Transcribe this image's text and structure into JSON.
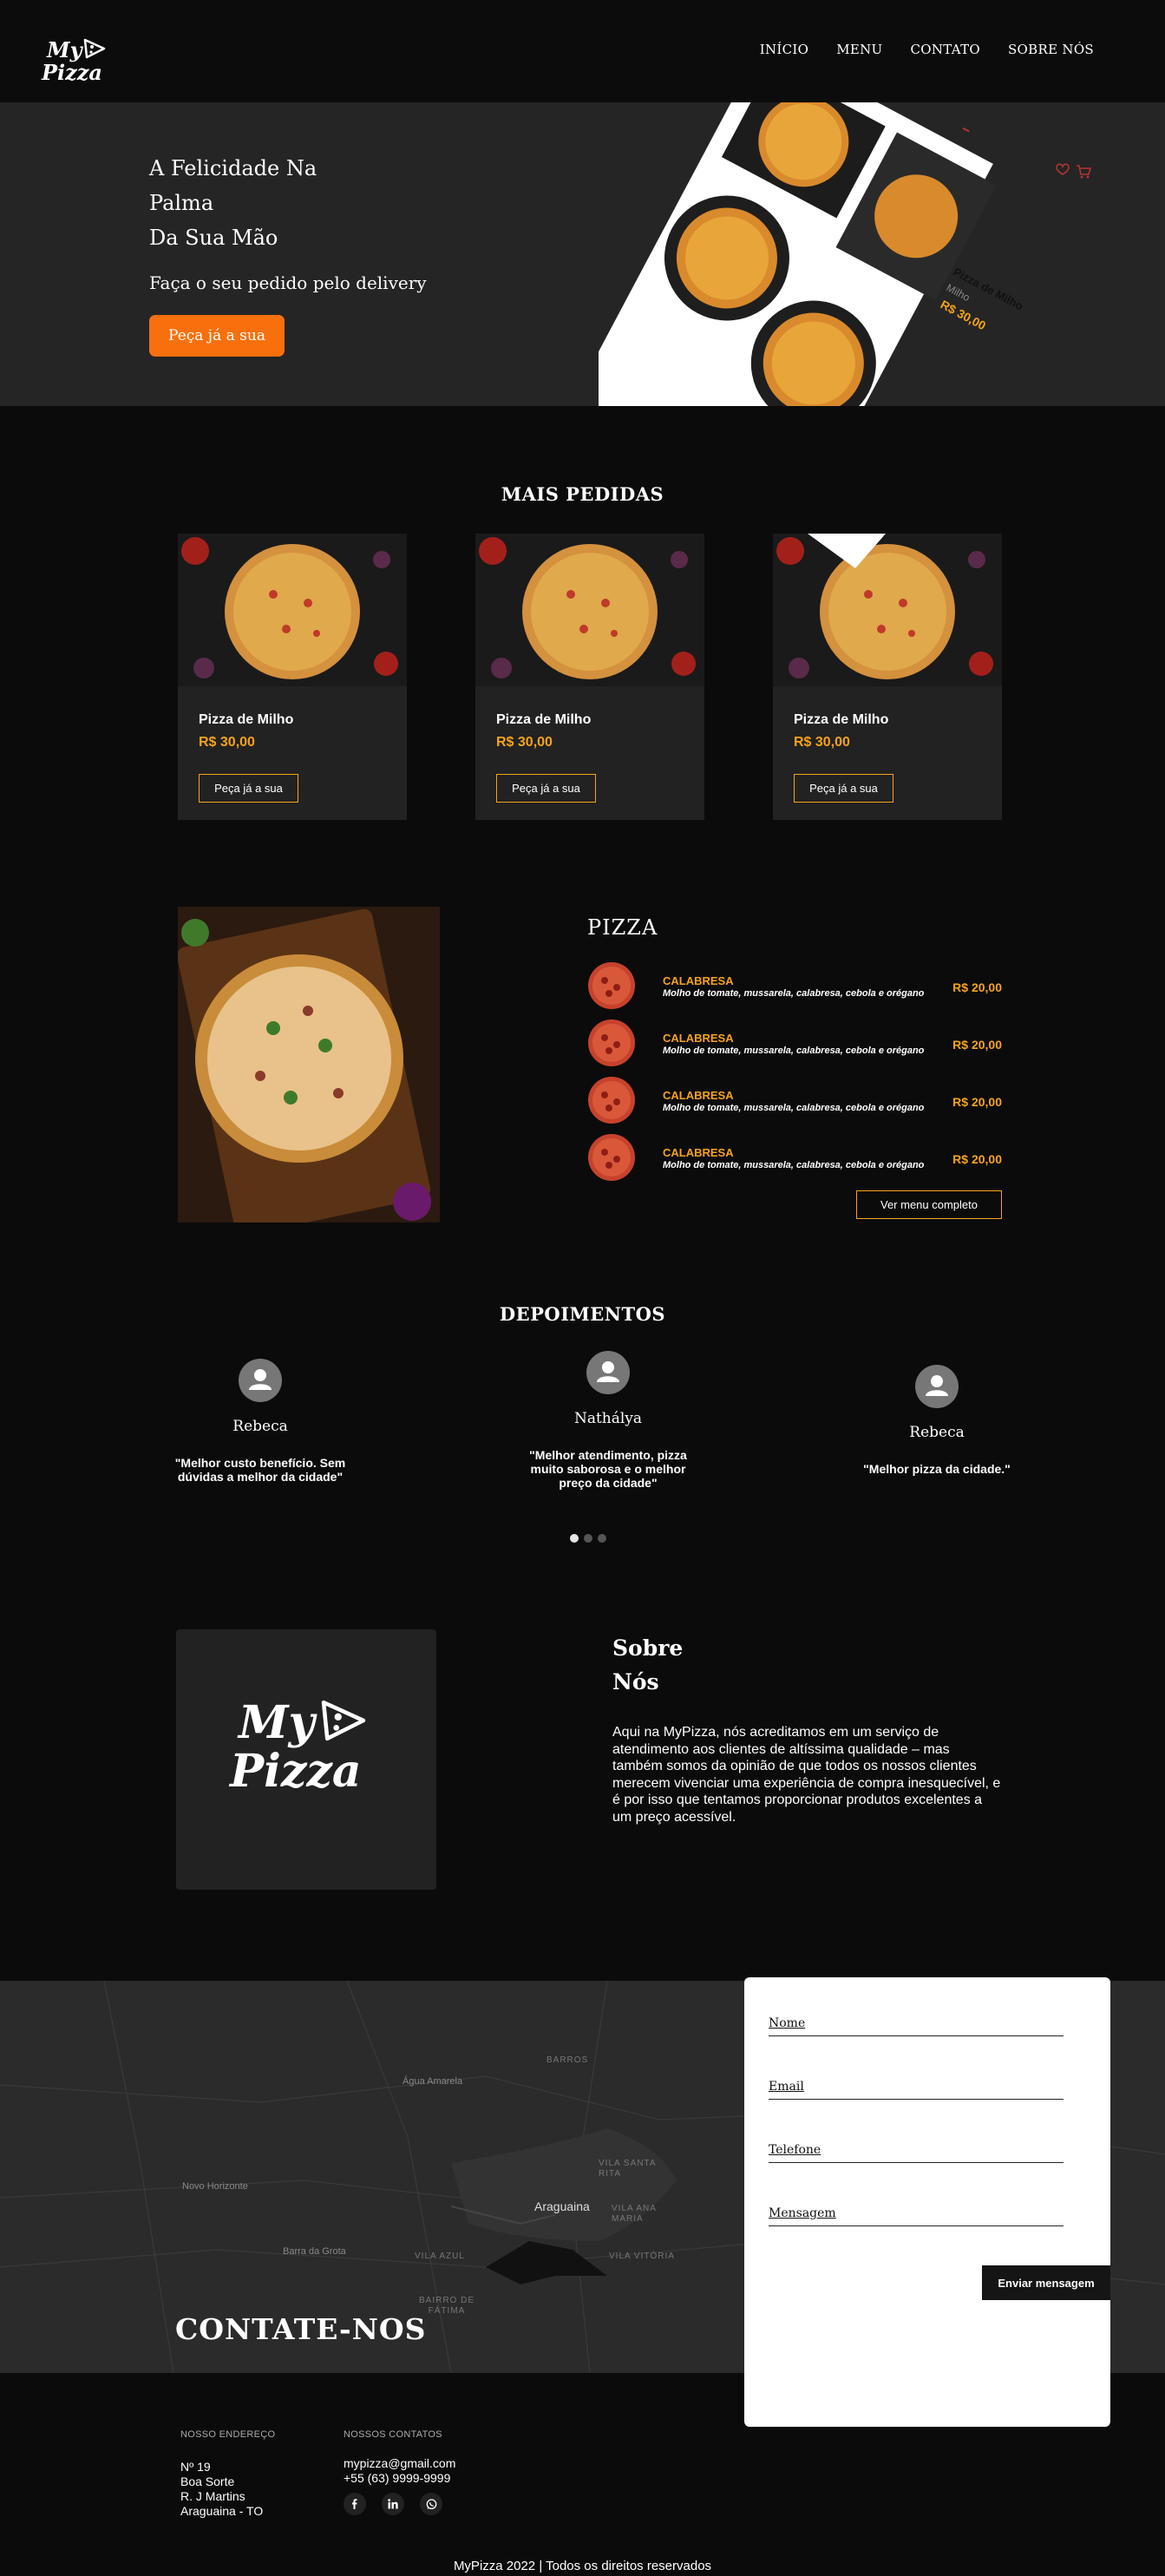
{
  "brand": {
    "logo_line1": "My",
    "logo_line2": "Pizza"
  },
  "nav": {
    "items": [
      "INÍCIO",
      "MENU",
      "CONTATO",
      "SOBRE NÓS"
    ]
  },
  "hero": {
    "lines": [
      "A Felicidade Na",
      "Palma",
      "Da Sua Mão"
    ],
    "subtitle": "Faça o seu pedido pelo delivery",
    "cta": "Peça já a sua",
    "mockup": {
      "product": "Pizza de Milho",
      "ingredient": "Milho",
      "price": "R$ 30,00"
    }
  },
  "featured": {
    "title": "MAIS PEDIDAS",
    "cards": [
      {
        "name": "Pizza de Milho",
        "price": "R$ 30,00",
        "cta": "Peça já a sua"
      },
      {
        "name": "Pizza de Milho",
        "price": "R$ 30,00",
        "cta": "Peça já a sua"
      },
      {
        "name": "Pizza de Milho",
        "price": "R$ 30,00",
        "cta": "Peça já a sua"
      }
    ]
  },
  "menu": {
    "title": "PIZZA",
    "items": [
      {
        "name": "CALABRESA",
        "desc": "Molho de tomate, mussarela, calabresa, cebola e orégano",
        "price": "R$ 20,00"
      },
      {
        "name": "CALABRESA",
        "desc": "Molho de tomate, mussarela, calabresa, cebola e orégano",
        "price": "R$ 20,00"
      },
      {
        "name": "CALABRESA",
        "desc": "Molho de tomate, mussarela, calabresa, cebola e orégano",
        "price": "R$ 20,00"
      },
      {
        "name": "CALABRESA",
        "desc": "Molho de tomate, mussarela, calabresa, cebola e orégano",
        "price": "R$ 20,00"
      }
    ],
    "full_menu_button": "Ver menu completo"
  },
  "testimonials": {
    "title": "DEPOIMENTOS",
    "items": [
      {
        "name": "Rebeca",
        "quote": "\"Melhor custo benefício. Sem dúvidas a melhor da cidade\""
      },
      {
        "name": "Nathályа",
        "quote": "\"Melhor atendimento, pizza muito saborosa e o melhor preço da cidade\""
      },
      {
        "name": "Rebeca",
        "quote": "\"Melhor pizza da cidade.\""
      }
    ],
    "active_dot": 0
  },
  "about": {
    "title_line1": "Sobre",
    "title_line2": "Nós",
    "text": "Aqui na MyPizza, nós acreditamos em um serviço de atendimento aos clientes de altíssima qualidade – mas também somos da opinião de que todos os nossos clientes merecem vivenciar uma experiência de compra inesquecível, e é por isso que tentamos proporcionar produtos excelentes a um preço acessível."
  },
  "contact": {
    "title": "CONTATE-NOS",
    "map_labels": [
      "BARROS",
      "Água Amarela",
      "Novo Horizonte",
      "VILA SANTA RITA",
      "Araguaina",
      "VILA ANA MARIA",
      "Barra da Grota",
      "VILA AZUL",
      "VILA VITÓRIA",
      "BAIRRO DE FÁTIMA"
    ],
    "form": {
      "name": "Nome",
      "email": "Email",
      "phone": "Telefone",
      "message": "Mensagem",
      "submit": "Enviar mensagem"
    }
  },
  "footer": {
    "address_heading": "NOSSO ENDEREÇO",
    "address": [
      "Nº 19",
      "Boa Sorte",
      "R. J Martins",
      "Araguaina - TO"
    ],
    "contacts_heading": "NOSSOS CONTATOS",
    "email": "mypizza@gmail.com",
    "phone": "+55 (63) 9999-9999",
    "social": [
      "facebook-icon",
      "linkedin-icon",
      "whatsapp-icon"
    ],
    "copyright": "MyPizza 2022 | Todos os direitos reservados"
  },
  "colors": {
    "accent": "#f7700d",
    "price": "#f7a31a",
    "bg": "#0b0b0b",
    "panel": "#222222"
  }
}
